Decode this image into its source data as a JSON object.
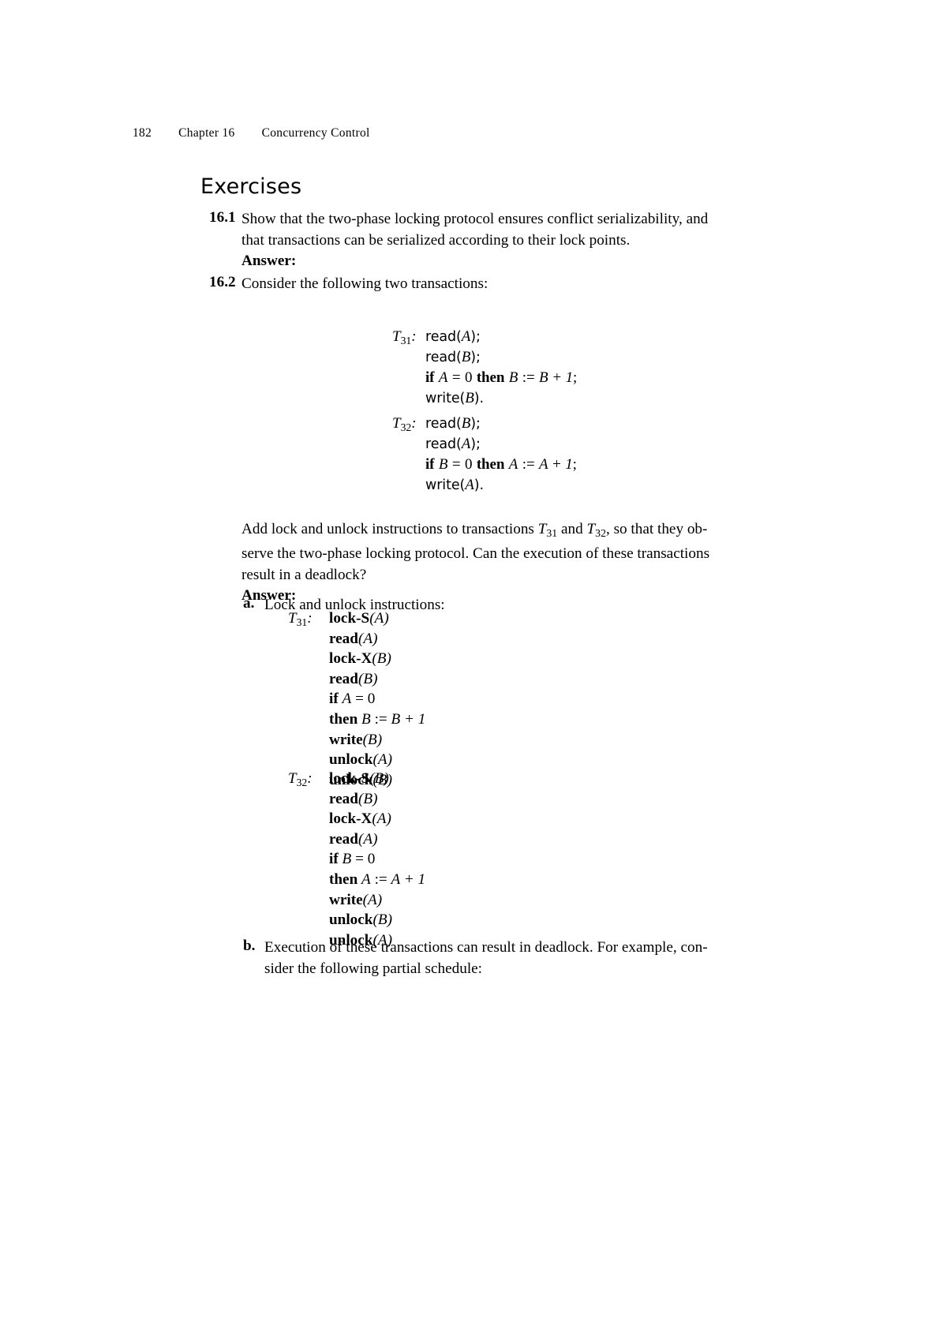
{
  "running_head": {
    "page_number": "182",
    "chapter": "Chapter 16",
    "chapter_title": "Concurrency Control"
  },
  "section": {
    "heading": "Exercises"
  },
  "exercises": [
    {
      "number": "16.1",
      "text_line_1": "Show that the two-phase locking protocol ensures conflict serializability, and",
      "text_line_2": "that transactions can be serialized according to their lock points.",
      "answer_label": "Answer:"
    },
    {
      "number": "16.2",
      "text_line_1": "Consider the following two transactions:"
    }
  ],
  "transactions": [
    {
      "label_base": "T",
      "label_sub": "31",
      "label_colon": ":",
      "lines": [
        {
          "fn": "read",
          "open": "(",
          "var": "A",
          "close": ")",
          "end": ";"
        },
        {
          "fn": "read",
          "open": "(",
          "var": "B",
          "close": ")",
          "end": ";"
        },
        {
          "if_kw": "if",
          "cond_var": "A",
          "cond_op": "=",
          "cond_val": "0",
          "then_kw": "then",
          "assign_lhs": "B",
          "assign_op": ":=",
          "assign_rhs": "B + 1",
          "end": ";"
        },
        {
          "fn": "write",
          "open": "(",
          "var": "B",
          "close": ")",
          "end": "."
        }
      ]
    },
    {
      "label_base": "T",
      "label_sub": "32",
      "label_colon": ":",
      "lines": [
        {
          "fn": "read",
          "open": "(",
          "var": "B",
          "close": ")",
          "end": ";"
        },
        {
          "fn": "read",
          "open": "(",
          "var": "A",
          "close": ")",
          "end": ";"
        },
        {
          "if_kw": "if",
          "cond_var": "B",
          "cond_op": "=",
          "cond_val": "0",
          "then_kw": "then",
          "assign_lhs": "A",
          "assign_op": ":=",
          "assign_rhs": "A + 1",
          "end": ";"
        },
        {
          "fn": "write",
          "open": "(",
          "var": "A",
          "close": ")",
          "end": "."
        }
      ]
    }
  ],
  "prompt_paragraph": {
    "line_1_pre": "Add lock and unlock instructions to transactions ",
    "line_1_t1_base": "T",
    "line_1_t1_sub": "31",
    "line_1_mid": " and ",
    "line_1_t2_base": "T",
    "line_1_t2_sub": "32",
    "line_1_post": ", so that they ob-",
    "line_2": "serve the two-phase locking protocol. Can the execution of these transactions",
    "line_3": "result in a deadlock?",
    "answer_label": "Answer:"
  },
  "answer": {
    "item_a_marker": "a.",
    "item_a_text": "Lock and unlock instructions:",
    "item_b_marker": "b.",
    "item_b_line_1": "Execution of these transactions can result in deadlock. For example, con-",
    "item_b_line_2": "sider the following partial schedule:",
    "lock_blocks": [
      {
        "label_base": "T",
        "label_sub": "31",
        "label_colon": ":",
        "rows": [
          {
            "kw": "lock-S",
            "open": "(",
            "var": "A",
            "close": ")"
          },
          {
            "kw": "read",
            "open": "(",
            "var": "A",
            "close": ")"
          },
          {
            "kw": "lock-X",
            "open": "(",
            "var": "B",
            "close": ")"
          },
          {
            "kw": "read",
            "open": "(",
            "var": "B",
            "close": ")"
          },
          {
            "kw": "if",
            "cond_var": "A",
            "cond_op": "=",
            "cond_val": "0"
          },
          {
            "kw": "then",
            "assign_lhs": "B",
            "assign_op": ":=",
            "assign_rhs": "B + 1"
          },
          {
            "kw": "write",
            "open": "(",
            "var": "B",
            "close": ")"
          },
          {
            "kw": "unlock",
            "open": "(",
            "var": "A",
            "close": ")"
          },
          {
            "kw": "unlock",
            "open": "(",
            "var": "B",
            "close": ")"
          }
        ]
      },
      {
        "label_base": "T",
        "label_sub": "32",
        "label_colon": ":",
        "rows": [
          {
            "kw": "lock-S",
            "open": "(",
            "var": "B",
            "close": ")"
          },
          {
            "kw": "read",
            "open": "(",
            "var": "B",
            "close": ")"
          },
          {
            "kw": "lock-X",
            "open": "(",
            "var": "A",
            "close": ")"
          },
          {
            "kw": "read",
            "open": "(",
            "var": "A",
            "close": ")"
          },
          {
            "kw": "if",
            "cond_var": "B",
            "cond_op": "=",
            "cond_val": "0"
          },
          {
            "kw": "then",
            "assign_lhs": "A",
            "assign_op": ":=",
            "assign_rhs": "A + 1"
          },
          {
            "kw": "write",
            "open": "(",
            "var": "A",
            "close": ")"
          },
          {
            "kw": "unlock",
            "open": "(",
            "var": "B",
            "close": ")"
          },
          {
            "kw": "unlock",
            "open": "(",
            "var": "A",
            "close": ")"
          }
        ]
      }
    ]
  },
  "colors": {
    "page_background": "#ffffff",
    "text": "#000000"
  }
}
